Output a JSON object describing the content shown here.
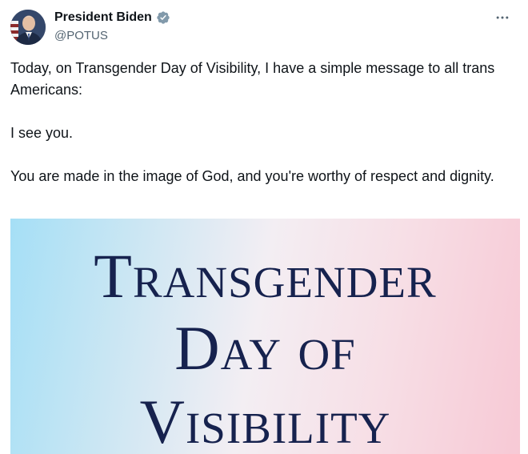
{
  "author": {
    "display_name": "President Biden",
    "handle": "@POTUS",
    "verified": true,
    "verified_color": "#829aab"
  },
  "tweet": {
    "paragraphs": [
      "Today, on Transgender Day of Visibility, I have a simple message to all trans Americans:",
      "I see you.",
      "You are made in the image of God, and you're worthy of respect and dignity."
    ]
  },
  "media": {
    "lines": [
      "Transgender",
      "Day of",
      "Visibility"
    ],
    "text_color": "#16224e",
    "gradient_colors": [
      "#a5dff6",
      "#f3eef3",
      "#f7c9d5"
    ]
  },
  "icons": {
    "more": "more-horizontal-icon",
    "verified": "verified-badge-icon"
  }
}
